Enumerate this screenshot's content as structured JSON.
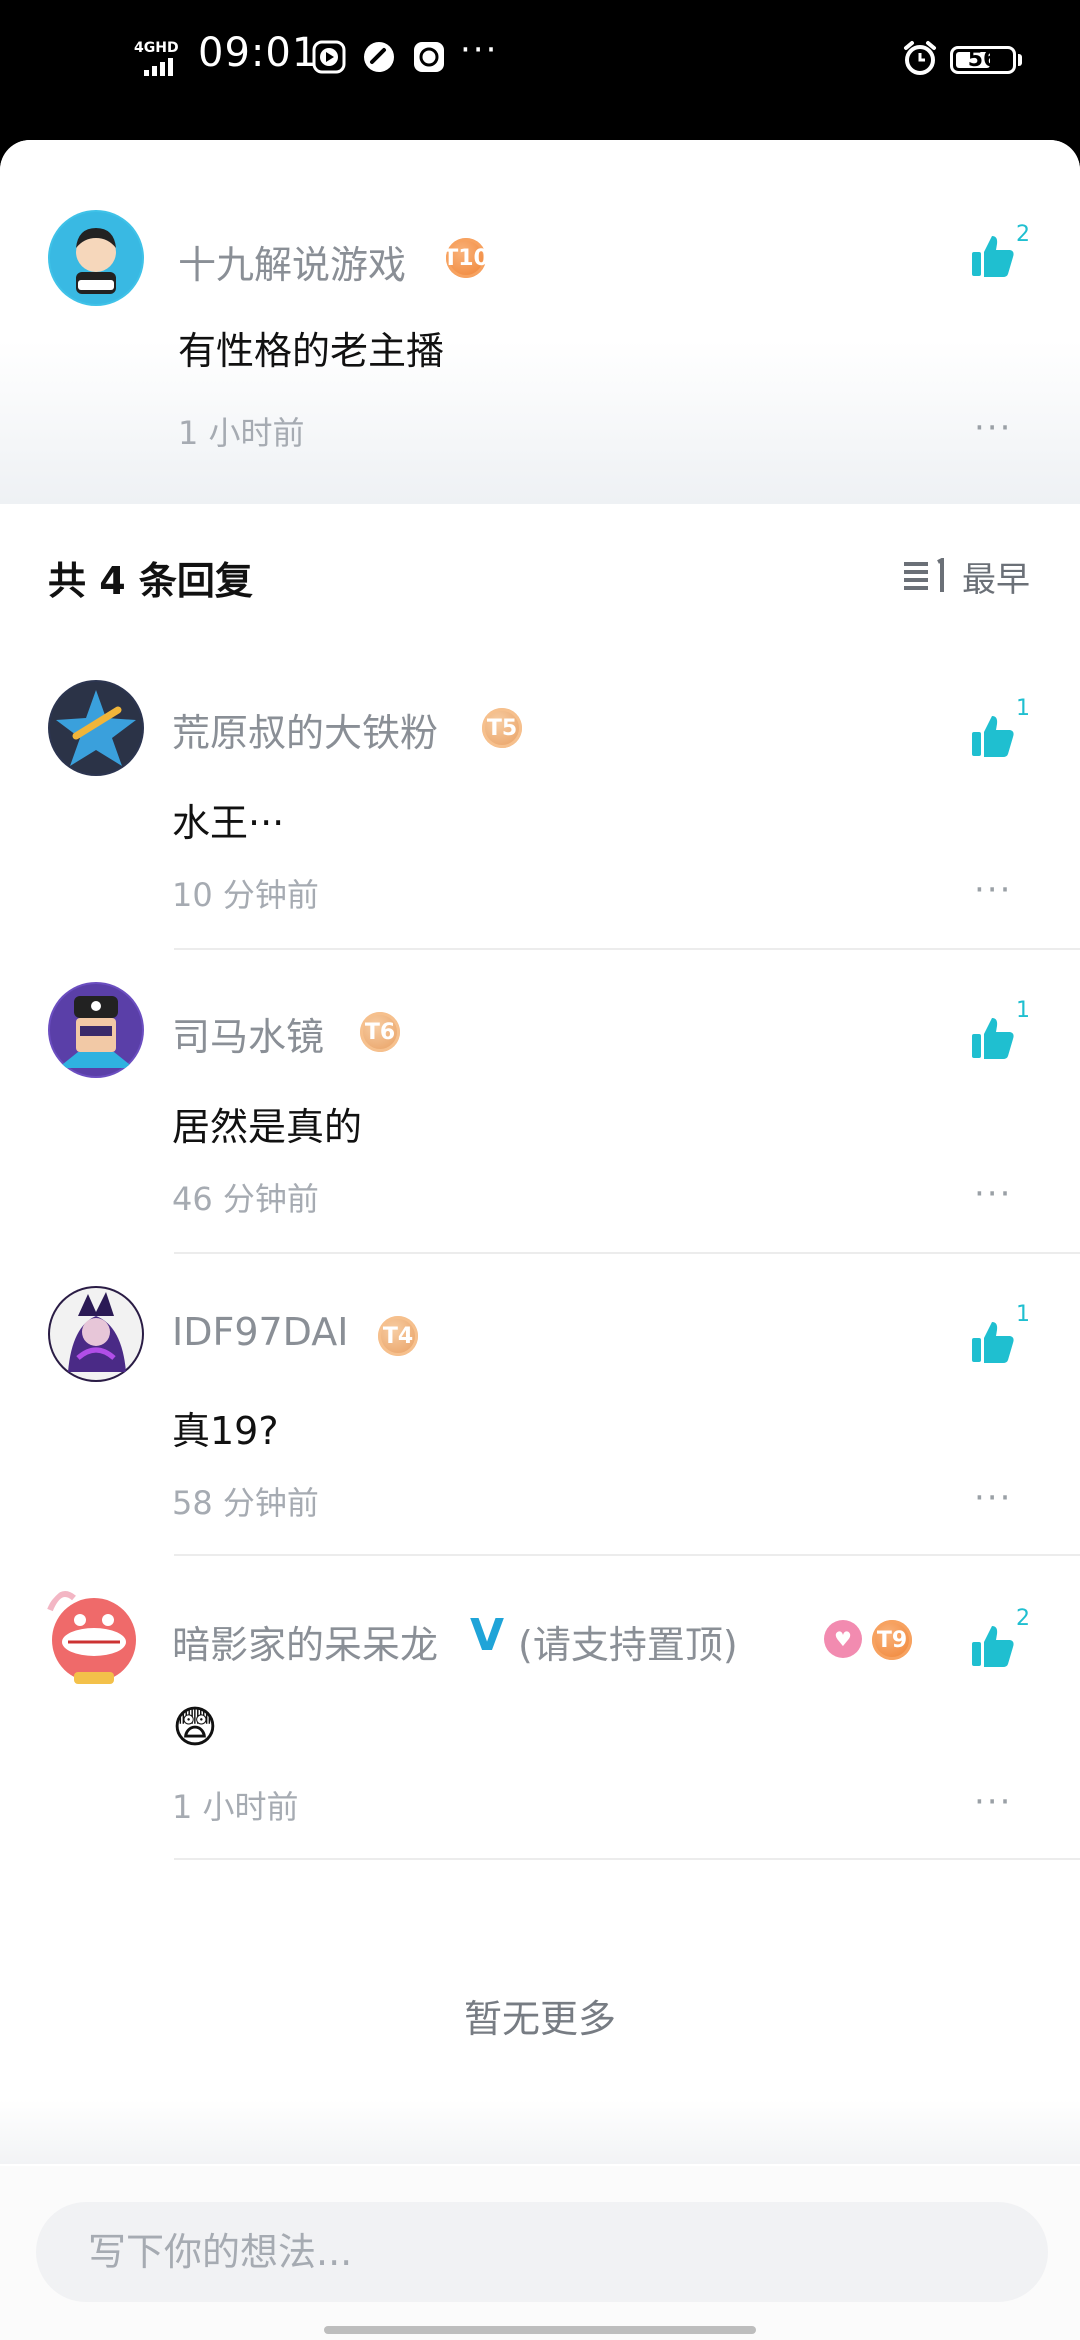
{
  "status_bar": {
    "network": "4GHD",
    "time": "09:01",
    "more": "···",
    "battery": "56"
  },
  "main_comment": {
    "username": "十九解说游戏",
    "level": "T10",
    "text": "有性格的老主播",
    "time": "1 小时前",
    "likes": "2",
    "more": "···"
  },
  "replies_header": {
    "count_text": "共 4 条回复",
    "sort_label": "最早"
  },
  "replies": [
    {
      "username": "荒原叔的大铁粉",
      "level": "T5",
      "text": "水王···",
      "time": "10 分钟前",
      "likes": "1",
      "more": "···"
    },
    {
      "username": "司马水镜",
      "level": "T6",
      "text": "居然是真的",
      "time": "46 分钟前",
      "likes": "1",
      "more": "···"
    },
    {
      "username": "IDF97DAI",
      "level": "T4",
      "text": "真19?",
      "time": "58 分钟前",
      "likes": "1",
      "more": "···"
    },
    {
      "username": "暗影家的呆呆龙",
      "verified": "V",
      "suffix": "(请支持置顶)",
      "level": "T9",
      "text": "😨",
      "time": "1 小时前",
      "likes": "2",
      "more": "···"
    }
  ],
  "footer": {
    "no_more": "暂无更多",
    "input_placeholder": "写下你的想法..."
  },
  "colors": {
    "accent": "#1fbfd0",
    "verified": "#1fa4d8",
    "secondary_text": "#8a8f96"
  }
}
